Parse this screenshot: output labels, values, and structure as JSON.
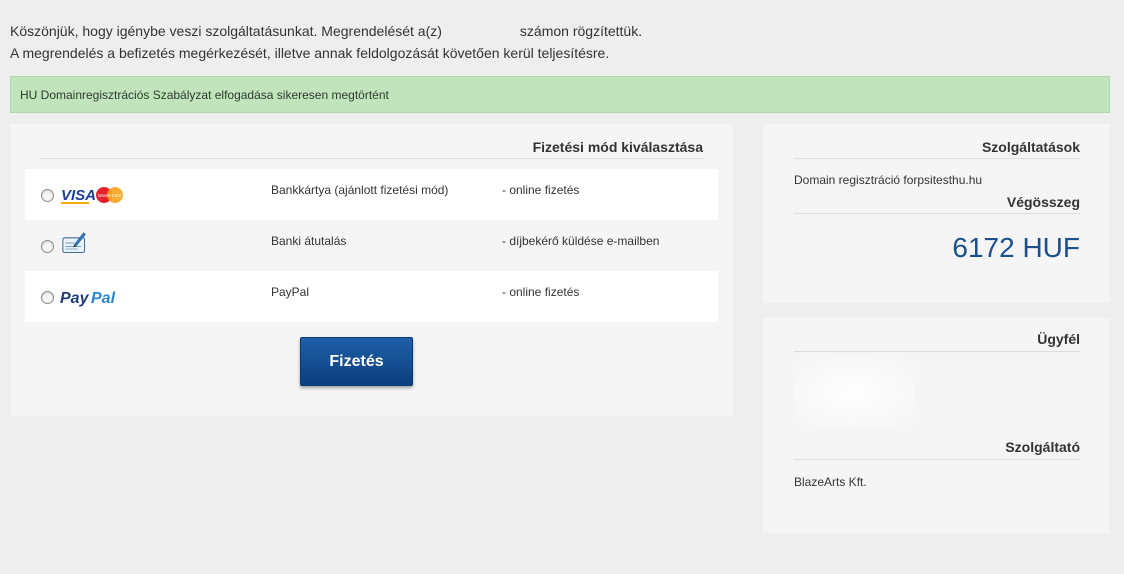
{
  "intro": {
    "line1_before": "Köszönjük, hogy igénybe veszi szolgáltatásunkat. Megrendelését a(z)",
    "line1_after": "számon rögzítettük.",
    "line2": "A megrendelés a befizetés megérkezését, illetve annak feldolgozását követően kerül teljesítésre."
  },
  "alert": {
    "text": "HU Domainregisztrációs Szabályzat elfogadása sikeresen megtörtént"
  },
  "payment": {
    "title": "Fizetési mód kiválasztása",
    "methods": [
      {
        "logo": "visa-mastercard-logo",
        "name": "Bankkártya (ajánlott fizetési mód)",
        "desc": "- online fizetés"
      },
      {
        "logo": "bank-check-icon",
        "name": "Banki átutalás",
        "desc": "- díjbekérő küldése e-mailben"
      },
      {
        "logo": "paypal-logo",
        "name": "PayPal",
        "desc": "- online fizetés"
      }
    ],
    "logos": {
      "visa": "VISA",
      "mastercard": "MasterCard",
      "paypal_pay": "Pay",
      "paypal_pal": "Pal"
    },
    "submit_label": "Fizetés"
  },
  "services": {
    "title": "Szolgáltatások",
    "item": "Domain regisztráció forpsitesthu.hu",
    "total_label": "Végösszeg",
    "total_value": "6172 HUF"
  },
  "customer": {
    "title": "Ügyfél",
    "provider_title": "Szolgáltató",
    "provider_name": "BlazeArts Kft."
  },
  "colors": {
    "accent": "#1a4f8b",
    "alert_bg": "#c1e4bd",
    "button": "#13519a"
  }
}
